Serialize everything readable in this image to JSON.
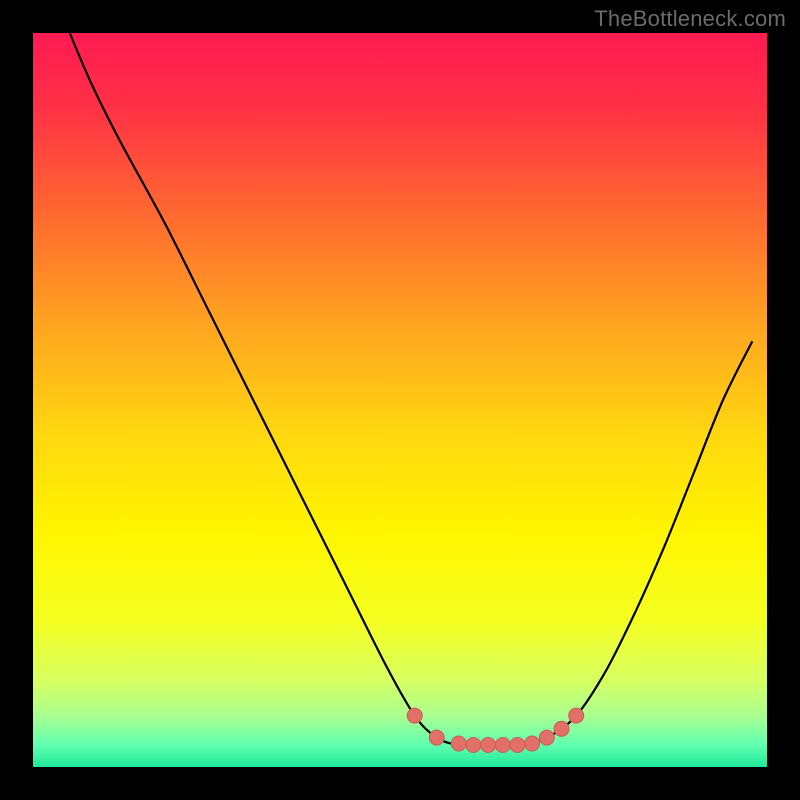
{
  "attribution": "TheBottleneck.com",
  "colors": {
    "background": "#000000",
    "gradient_stops": [
      {
        "offset": 0.0,
        "color": "#ff1a52"
      },
      {
        "offset": 0.1,
        "color": "#ff3046"
      },
      {
        "offset": 0.25,
        "color": "#ff6a30"
      },
      {
        "offset": 0.4,
        "color": "#ffa520"
      },
      {
        "offset": 0.55,
        "color": "#ffd810"
      },
      {
        "offset": 0.68,
        "color": "#fff500"
      },
      {
        "offset": 0.8,
        "color": "#f4ff20"
      },
      {
        "offset": 0.88,
        "color": "#d8ff60"
      },
      {
        "offset": 0.93,
        "color": "#aaff90"
      },
      {
        "offset": 0.97,
        "color": "#60ffb0"
      },
      {
        "offset": 1.0,
        "color": "#20e89a"
      }
    ],
    "curve": "#000000",
    "marker_fill": "#e07068",
    "marker_stroke": "#d05a52"
  },
  "chart_data": {
    "type": "line",
    "title": "",
    "xlabel": "",
    "ylabel": "",
    "xlim": [
      0,
      100
    ],
    "ylim": [
      0,
      100
    ],
    "series": [
      {
        "name": "bottleneck-curve",
        "x": [
          5,
          8,
          12,
          18,
          24,
          30,
          36,
          42,
          48,
          52,
          55,
          58,
          62,
          66,
          70,
          74,
          78,
          82,
          86,
          90,
          94,
          98
        ],
        "y": [
          100,
          93,
          85,
          74,
          62,
          50,
          38,
          26,
          14,
          7,
          4,
          3,
          3,
          3,
          4,
          7,
          13,
          21,
          30,
          40,
          50,
          58
        ]
      }
    ],
    "markers": {
      "name": "highlight-dots",
      "points": [
        {
          "x": 52,
          "y": 7
        },
        {
          "x": 55,
          "y": 4
        },
        {
          "x": 58,
          "y": 3.2
        },
        {
          "x": 60,
          "y": 3
        },
        {
          "x": 62,
          "y": 3
        },
        {
          "x": 64,
          "y": 3
        },
        {
          "x": 66,
          "y": 3
        },
        {
          "x": 68,
          "y": 3.2
        },
        {
          "x": 70,
          "y": 4
        },
        {
          "x": 72,
          "y": 5.2
        },
        {
          "x": 74,
          "y": 7
        }
      ]
    }
  }
}
